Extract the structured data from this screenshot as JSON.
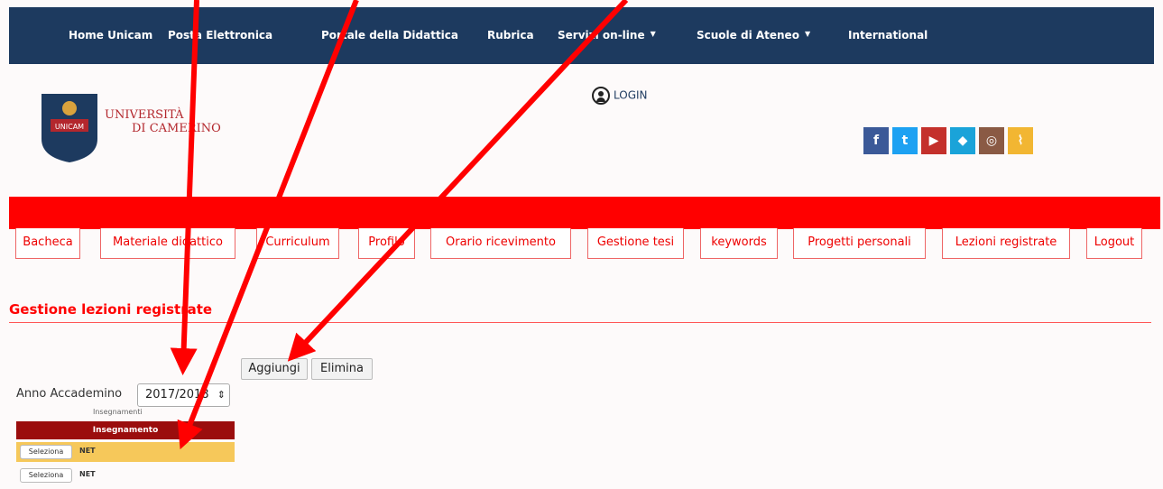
{
  "nav": {
    "items": [
      "Home Unicam",
      "Posta Elettronica",
      "Portale della Didattica",
      "Rubrica",
      "Servizi on-line",
      "Scuole di Ateneo",
      "International"
    ]
  },
  "logo": {
    "line1": "UNIVERSITÀ",
    "line2": "DI CAMERINO",
    "shield_text": "UNICAM"
  },
  "login": {
    "label": "LOGIN"
  },
  "social": {
    "icons": [
      "facebook-icon",
      "twitter-icon",
      "youtube-icon",
      "dropbox-icon",
      "instagram-icon",
      "rss-icon"
    ],
    "colors": [
      "#3b5998",
      "#1da1f2",
      "#c4302b",
      "#1aa3d9",
      "#8a5a44",
      "#f2b632"
    ]
  },
  "tabs": [
    "Bacheca",
    "Materiale didattico",
    "Curriculum",
    "Profilo",
    "Orario ricevimento",
    "Gestione tesi",
    "keywords",
    "Progetti personali",
    "Lezioni registrate",
    "Logout"
  ],
  "section": {
    "title": "Gestione lezioni registrate"
  },
  "buttons": {
    "add": "Aggiungi",
    "delete": "Elimina"
  },
  "anno": {
    "label": "Anno Accademino",
    "value": "2017/2018"
  },
  "table": {
    "caption": "Insegnamenti",
    "header": "Insegnamento",
    "rows": [
      {
        "button": "Seleziona",
        "name": "NET"
      },
      {
        "button": "Seleziona",
        "name": "NET"
      }
    ]
  },
  "colors": {
    "nav_bg": "#1d3a5f",
    "accent_red": "#ff0000",
    "header_dark_red": "#9b0d0d",
    "selected_row": "#f6c85a"
  }
}
